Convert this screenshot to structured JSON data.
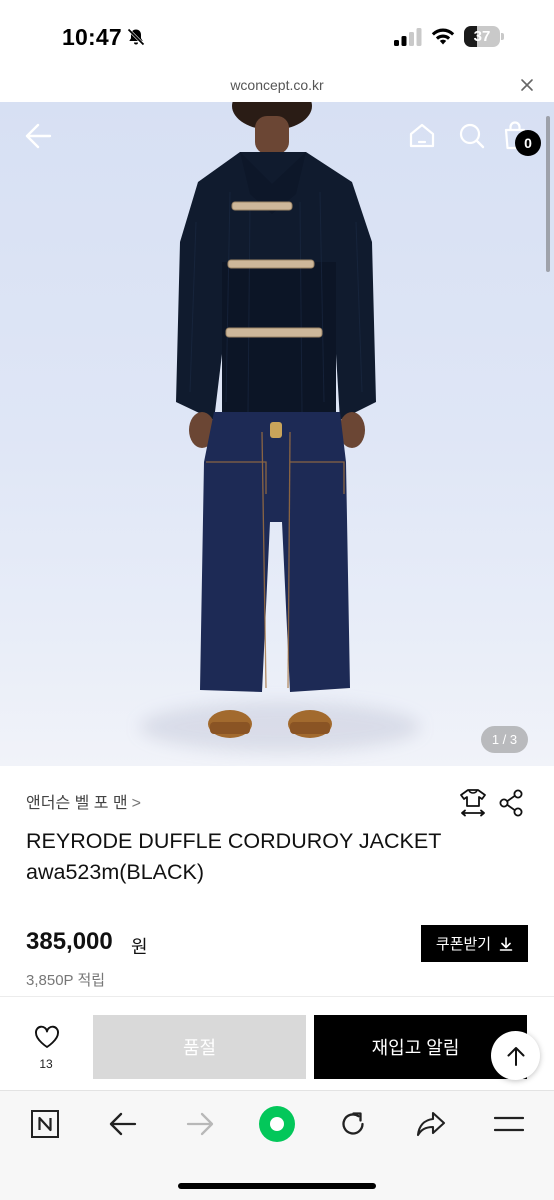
{
  "status_bar": {
    "time": "10:47",
    "battery_level": "37",
    "battery_fraction": 0.37,
    "icons": [
      "bell-slash-icon",
      "signal-icon",
      "wifi-icon",
      "battery-icon"
    ]
  },
  "browser": {
    "url": "wconcept.co.kr",
    "close_icon": "close-icon"
  },
  "hero": {
    "cart_count": "0",
    "image_counter": "1 / 3",
    "icons": [
      "back-arrow-icon",
      "home-icon",
      "search-icon",
      "shopping-bag-icon"
    ]
  },
  "product": {
    "brand": "앤더슨 벨 포 맨",
    "brand_chevron": ">",
    "title": "REYRODE DUFFLE CORDUROY JACKET awa523m(BLACK)",
    "price": "385,000",
    "price_unit": "원",
    "points": "3,850P 적립",
    "coupon_label": "쿠폰받기"
  },
  "actions": {
    "like_count": "13",
    "soldout_label": "품절",
    "restock_label": "재입고 알림"
  },
  "colors": {
    "accent": "#000000",
    "disabled_button": "#d9d9d9",
    "naver_green": "#03c75a",
    "hero_background": "#dbe3f4"
  },
  "toolbar": {
    "icons": [
      "naver-n-icon",
      "back-icon",
      "forward-icon",
      "naver-green-dot-icon",
      "refresh-icon",
      "share-arrow-icon",
      "menu-icon"
    ]
  }
}
